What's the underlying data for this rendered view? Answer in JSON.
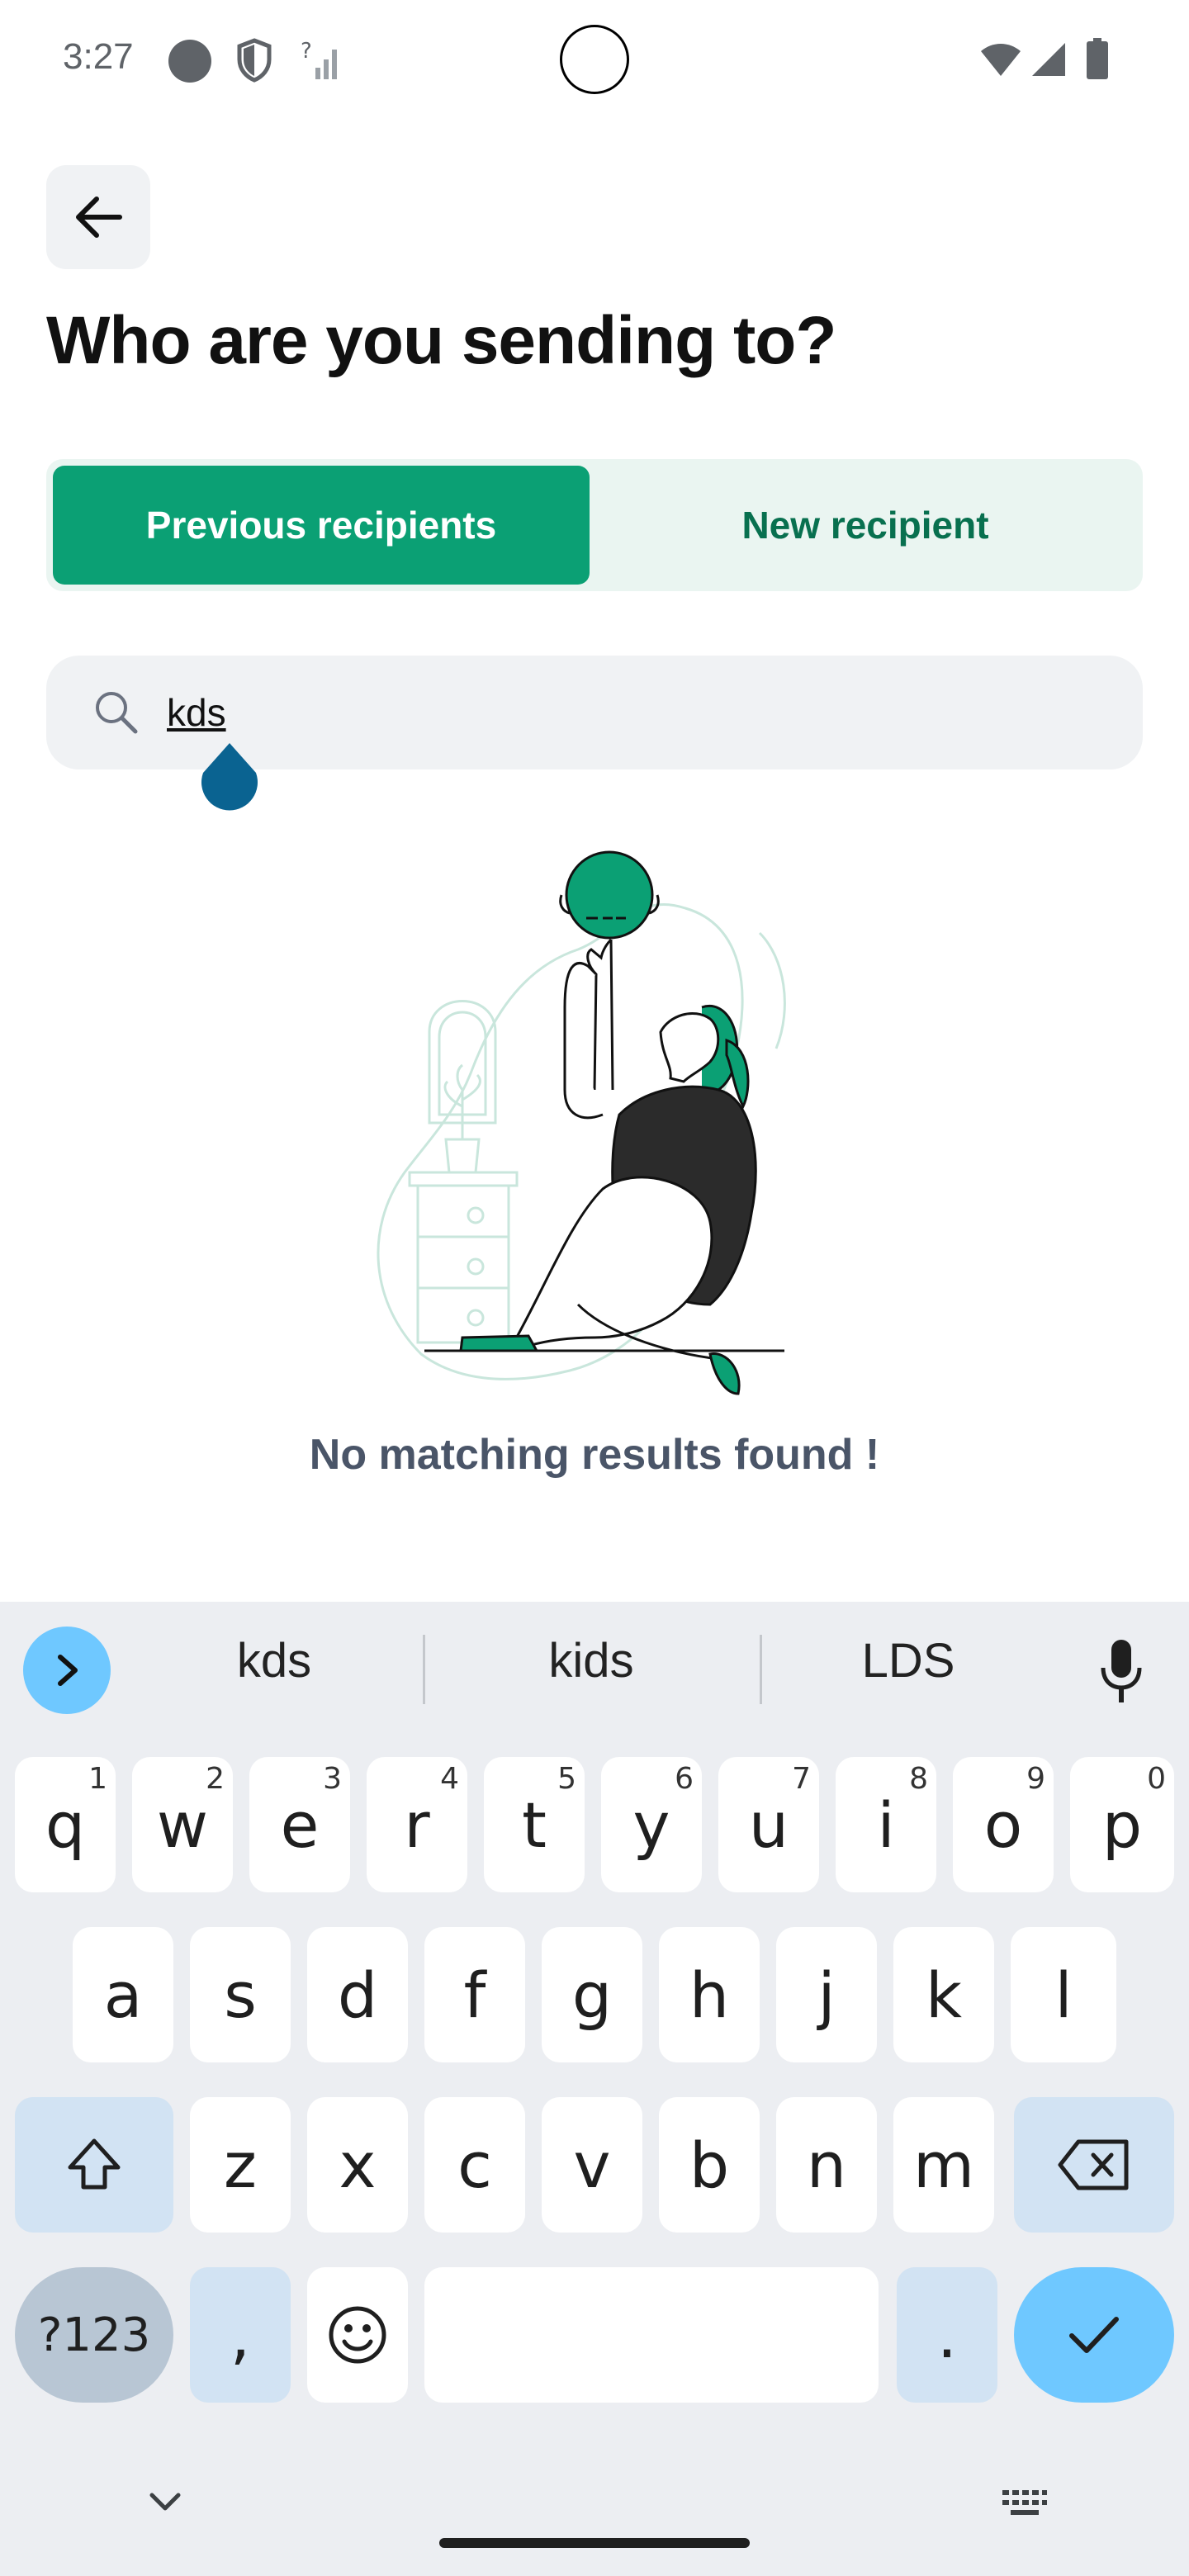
{
  "status_bar": {
    "time": "3:27"
  },
  "header": {
    "title": "Who are you sending to?"
  },
  "tabs": [
    {
      "label": "Previous recipients",
      "active": true
    },
    {
      "label": "New recipient",
      "active": false
    }
  ],
  "search": {
    "value": "kds"
  },
  "empty_state": {
    "message": "No matching results found !"
  },
  "keyboard": {
    "suggestions": [
      "kds",
      "kids",
      "LDS"
    ],
    "row1": [
      {
        "key": "q",
        "hint": "1"
      },
      {
        "key": "w",
        "hint": "2"
      },
      {
        "key": "e",
        "hint": "3"
      },
      {
        "key": "r",
        "hint": "4"
      },
      {
        "key": "t",
        "hint": "5"
      },
      {
        "key": "y",
        "hint": "6"
      },
      {
        "key": "u",
        "hint": "7"
      },
      {
        "key": "i",
        "hint": "8"
      },
      {
        "key": "o",
        "hint": "9"
      },
      {
        "key": "p",
        "hint": "0"
      }
    ],
    "row2": [
      "a",
      "s",
      "d",
      "f",
      "g",
      "h",
      "j",
      "k",
      "l"
    ],
    "row3": [
      "z",
      "x",
      "c",
      "v",
      "b",
      "n",
      "m"
    ],
    "symbols_label": "?123",
    "comma": ",",
    "period": "."
  },
  "colors": {
    "accent": "#0ba074",
    "accent_dark": "#08704f",
    "segment_bg": "#eaf5f1",
    "keyboard_bg": "#eceef2",
    "key_blue": "#6fc8ff"
  }
}
